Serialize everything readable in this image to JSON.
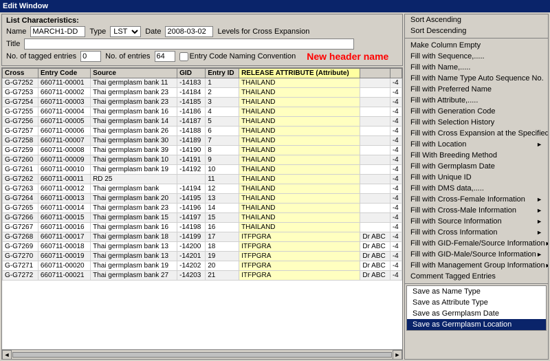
{
  "window": {
    "title": "Edit Window"
  },
  "menu": {
    "items": [
      "Edit Window"
    ]
  },
  "listCharacteristics": {
    "label": "List Characteristics:",
    "nameLabel": "Name",
    "nameValue": "MARCH1-DD",
    "typeLabel": "Type",
    "typeValue": "LST",
    "dateLabel": "Date",
    "dateValue": "2008-03-02",
    "levelsLabel": "Levels for Cross Expansion",
    "titleLabel": "Title",
    "titleValue": "",
    "taggedLabel": "No. of tagged entries",
    "taggedValue": "0",
    "entriesLabel": "No. of entries",
    "entriesValue": "64",
    "entryCodeLabel": "Entry Code Naming Convention"
  },
  "newHeaderHighlight": "New header name",
  "tableHeaders": [
    "Cross",
    "Entry Code",
    "Source",
    "GID",
    "Entry ID",
    "RELEASE ATTRIBUTE (Attribute)",
    "",
    ""
  ],
  "tableRows": [
    [
      "G-G7252",
      "660711-00001",
      "Thai germplasm bank 11",
      "-14183",
      "1",
      "THAILAND",
      "",
      "-4"
    ],
    [
      "G-G7253",
      "660711-00002",
      "Thai germplasm bank 23",
      "-14184",
      "2",
      "THAILAND",
      "",
      "-4"
    ],
    [
      "G-G7254",
      "660711-00003",
      "Thai germplasm bank 23",
      "-14185",
      "3",
      "THAILAND",
      "",
      "-4"
    ],
    [
      "G-G7255",
      "660711-00004",
      "Thai germplasm bank 16",
      "-14186",
      "4",
      "THAILAND",
      "",
      "-4"
    ],
    [
      "G-G7256",
      "660711-00005",
      "Thai germplasm bank 14",
      "-14187",
      "5",
      "THAILAND",
      "",
      "-4"
    ],
    [
      "G-G7257",
      "660711-00006",
      "Thai germplasm bank 26",
      "-14188",
      "6",
      "THAILAND",
      "",
      "-4"
    ],
    [
      "G-G7258",
      "660711-00007",
      "Thai germplasm bank 30",
      "-14189",
      "7",
      "THAILAND",
      "",
      "-4"
    ],
    [
      "G-G7259",
      "660711-00008",
      "Thai germplasm bank 39",
      "-14190",
      "8",
      "THAILAND",
      "",
      "-4"
    ],
    [
      "G-G7260",
      "660711-00009",
      "Thai germplasm bank 10",
      "-14191",
      "9",
      "THAILAND",
      "",
      "-4"
    ],
    [
      "G-G7261",
      "660711-00010",
      "Thai germplasm bank 19",
      "-14192",
      "10",
      "THAILAND",
      "",
      "-4"
    ],
    [
      "G-G7262",
      "660711-00011",
      "RD 25",
      "",
      "11",
      "THAILAND",
      "",
      "-4"
    ],
    [
      "G-G7263",
      "660711-00012",
      "Thai germplasm bank",
      "-14194",
      "12",
      "THAILAND",
      "",
      "-4"
    ],
    [
      "G-G7264",
      "660711-00013",
      "Thai germplasm bank 20",
      "-14195",
      "13",
      "THAILAND",
      "",
      "-4"
    ],
    [
      "G-G7265",
      "660711-00014",
      "Thai germplasm bank 23",
      "-14196",
      "14",
      "THAILAND",
      "",
      "-4"
    ],
    [
      "G-G7266",
      "660711-00015",
      "Thai germplasm bank 15",
      "-14197",
      "15",
      "THAILAND",
      "",
      "-4"
    ],
    [
      "G-G7267",
      "660711-00016",
      "Thai germplasm bank 16",
      "-14198",
      "16",
      "THAILAND",
      "",
      "-4"
    ],
    [
      "G-G7268",
      "660711-00017",
      "Thai germplasm bank 18",
      "-14199",
      "17",
      "ITFPGRA",
      "Dr ABC",
      "-4"
    ],
    [
      "G-G7269",
      "660711-00018",
      "Thai germplasm bank 13",
      "-14200",
      "18",
      "ITFPGRA",
      "Dr ABC",
      "-4"
    ],
    [
      "G-G7270",
      "660711-00019",
      "Thai germplasm bank 13",
      "-14201",
      "19",
      "ITFPGRA",
      "Dr ABC",
      "-4"
    ],
    [
      "G-G7271",
      "660711-00020",
      "Thai germplasm bank 19",
      "-14202",
      "20",
      "ITFPGRA",
      "Dr ABC",
      "-4"
    ],
    [
      "G-G7272",
      "660711-00021",
      "Thai germplasm bank 27",
      "-14203",
      "21",
      "ITFPGRA",
      "Dr ABC",
      "-4"
    ]
  ],
  "contextMenu": {
    "topItems": [
      {
        "label": "Sort Ascending",
        "highlighted": false,
        "hasArrow": false
      },
      {
        "label": "Sort Descending",
        "highlighted": false,
        "hasArrow": false
      }
    ],
    "middleItems": [
      {
        "label": "Make Column Empty",
        "highlighted": false,
        "hasArrow": false
      },
      {
        "label": "Fill with Sequence,.....",
        "highlighted": false,
        "hasArrow": false
      },
      {
        "label": "Fill with Name,.....",
        "highlighted": false,
        "hasArrow": false
      },
      {
        "label": "Fill with Name Type Auto Sequence No.",
        "highlighted": false,
        "hasArrow": false
      },
      {
        "label": "Fill with Preferred Name",
        "highlighted": false,
        "hasArrow": false
      },
      {
        "label": "Fill with Attribute,.....",
        "highlighted": false,
        "hasArrow": false
      },
      {
        "label": "Fill with Generation Code",
        "highlighted": false,
        "hasArrow": false
      },
      {
        "label": "Fill with Selection History",
        "highlighted": false,
        "hasArrow": false
      },
      {
        "label": "Fill with Cross Expansion at the Specified Level",
        "highlighted": false,
        "hasArrow": false
      },
      {
        "label": "Fill with Location",
        "highlighted": false,
        "hasArrow": true
      },
      {
        "label": "Fill With Breeding Method",
        "highlighted": false,
        "hasArrow": false
      },
      {
        "label": "Fill with Germplasm Date",
        "highlighted": false,
        "hasArrow": false
      },
      {
        "label": "Fill with Unique ID",
        "highlighted": false,
        "hasArrow": false
      },
      {
        "label": "Fill with DMS data,.....",
        "highlighted": false,
        "hasArrow": false
      },
      {
        "label": "Fill with Cross-Female Information",
        "highlighted": false,
        "hasArrow": true
      },
      {
        "label": "Fill with Cross-Male Information",
        "highlighted": false,
        "hasArrow": true
      },
      {
        "label": "Fill with Source Information",
        "highlighted": false,
        "hasArrow": true
      },
      {
        "label": "Fill with Cross Information",
        "highlighted": false,
        "hasArrow": true
      },
      {
        "label": "Fill with GID-Female/Source Information",
        "highlighted": false,
        "hasArrow": true
      },
      {
        "label": "Fill with GID-Male/Source Information",
        "highlighted": false,
        "hasArrow": true
      },
      {
        "label": "Fill with Management Group Information",
        "highlighted": false,
        "hasArrow": true
      },
      {
        "label": "Comment Tagged Entries",
        "highlighted": false,
        "hasArrow": false
      }
    ],
    "bottomItems": [
      {
        "label": "Save as Name Type",
        "highlighted": false,
        "hasArrow": false
      },
      {
        "label": "Save as Attribute Type",
        "highlighted": false,
        "hasArrow": false
      },
      {
        "label": "Save as Germplasm Date",
        "highlighted": false,
        "hasArrow": false
      },
      {
        "label": "Save as Germplasm Location",
        "highlighted": true,
        "hasArrow": false
      }
    ]
  }
}
